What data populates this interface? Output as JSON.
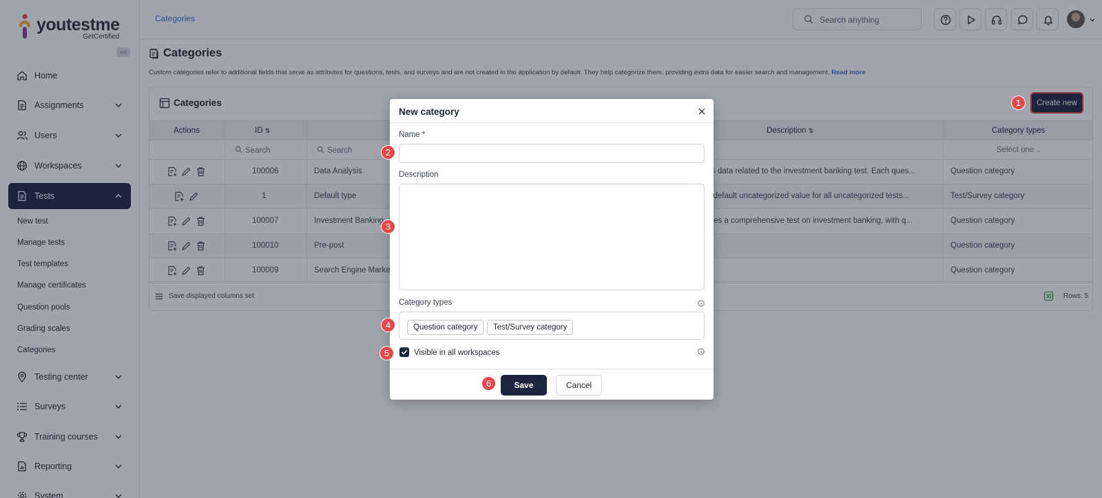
{
  "logo": {
    "name": "youtestme",
    "sub": "GetCertified"
  },
  "sidebar": {
    "collapse_label": "<<",
    "items": [
      {
        "label": "Home",
        "icon": "home-icon"
      },
      {
        "label": "Assignments",
        "icon": "document-icon"
      },
      {
        "label": "Users",
        "icon": "users-icon"
      },
      {
        "label": "Workspaces",
        "icon": "globe-icon"
      },
      {
        "label": "Tests",
        "icon": "test-icon"
      },
      {
        "label": "Testing center",
        "icon": "location-icon"
      },
      {
        "label": "Surveys",
        "icon": "list-icon"
      },
      {
        "label": "Training courses",
        "icon": "trophy-icon"
      },
      {
        "label": "Reporting",
        "icon": "report-icon"
      },
      {
        "label": "System",
        "icon": "gear-icon"
      }
    ],
    "tests_sub": [
      "New test",
      "Manage tests",
      "Test templates",
      "Manage certificates",
      "Question pools",
      "Grading scales",
      "Categories"
    ]
  },
  "topbar": {
    "breadcrumb": "Categories",
    "search_placeholder": "Search anything"
  },
  "page": {
    "title": "Categories",
    "description": "Custom categories refer to additional fields that serve as attributes for questions, tests, and surveys and are not created in the application by default. They help categorize them, providing extra data for easier search and management.",
    "read_more": "Read more"
  },
  "panel": {
    "title": "Categories",
    "create_new": "Create new",
    "columns": {
      "actions": "Actions",
      "id": "ID",
      "description": "Description",
      "types": "Category types"
    },
    "filters": {
      "search": "Search",
      "select_one": "Select one"
    },
    "rows": [
      {
        "id": "100006",
        "name": "Data Analysis",
        "description": "ntains data related to the investment banking test. Each ques...",
        "type": "Question category"
      },
      {
        "id": "1",
        "name": "Default type",
        "description": "tains default uncategorized value for all uncategorized tests...",
        "type": "Test/Survey category"
      },
      {
        "id": "100007",
        "name": "Investment Banking",
        "description": "mprises a comprehensive test on investment banking, with q...",
        "type": "Question category"
      },
      {
        "id": "100010",
        "name": "Pre-post",
        "description": "",
        "type": "Question category"
      },
      {
        "id": "100009",
        "name": "Search Engine Marke",
        "description": "",
        "type": "Question category"
      }
    ],
    "footer_save": "Save displayed columns set",
    "rows_count": "Rows: 5"
  },
  "modal": {
    "title": "New category",
    "name_label": "Name *",
    "name_value": "",
    "description_label": "Description",
    "description_value": "",
    "category_types_label": "Category types",
    "category_types": [
      "Question category",
      "Test/Survey category"
    ],
    "visible_label": "Visible in all workspaces",
    "save": "Save",
    "cancel": "Cancel"
  },
  "steps": [
    "1",
    "2",
    "3",
    "4",
    "5",
    "6"
  ],
  "colors": {
    "primary": "#1b2440",
    "accent_link": "#2f6bd8",
    "badge": "#e8484a"
  }
}
